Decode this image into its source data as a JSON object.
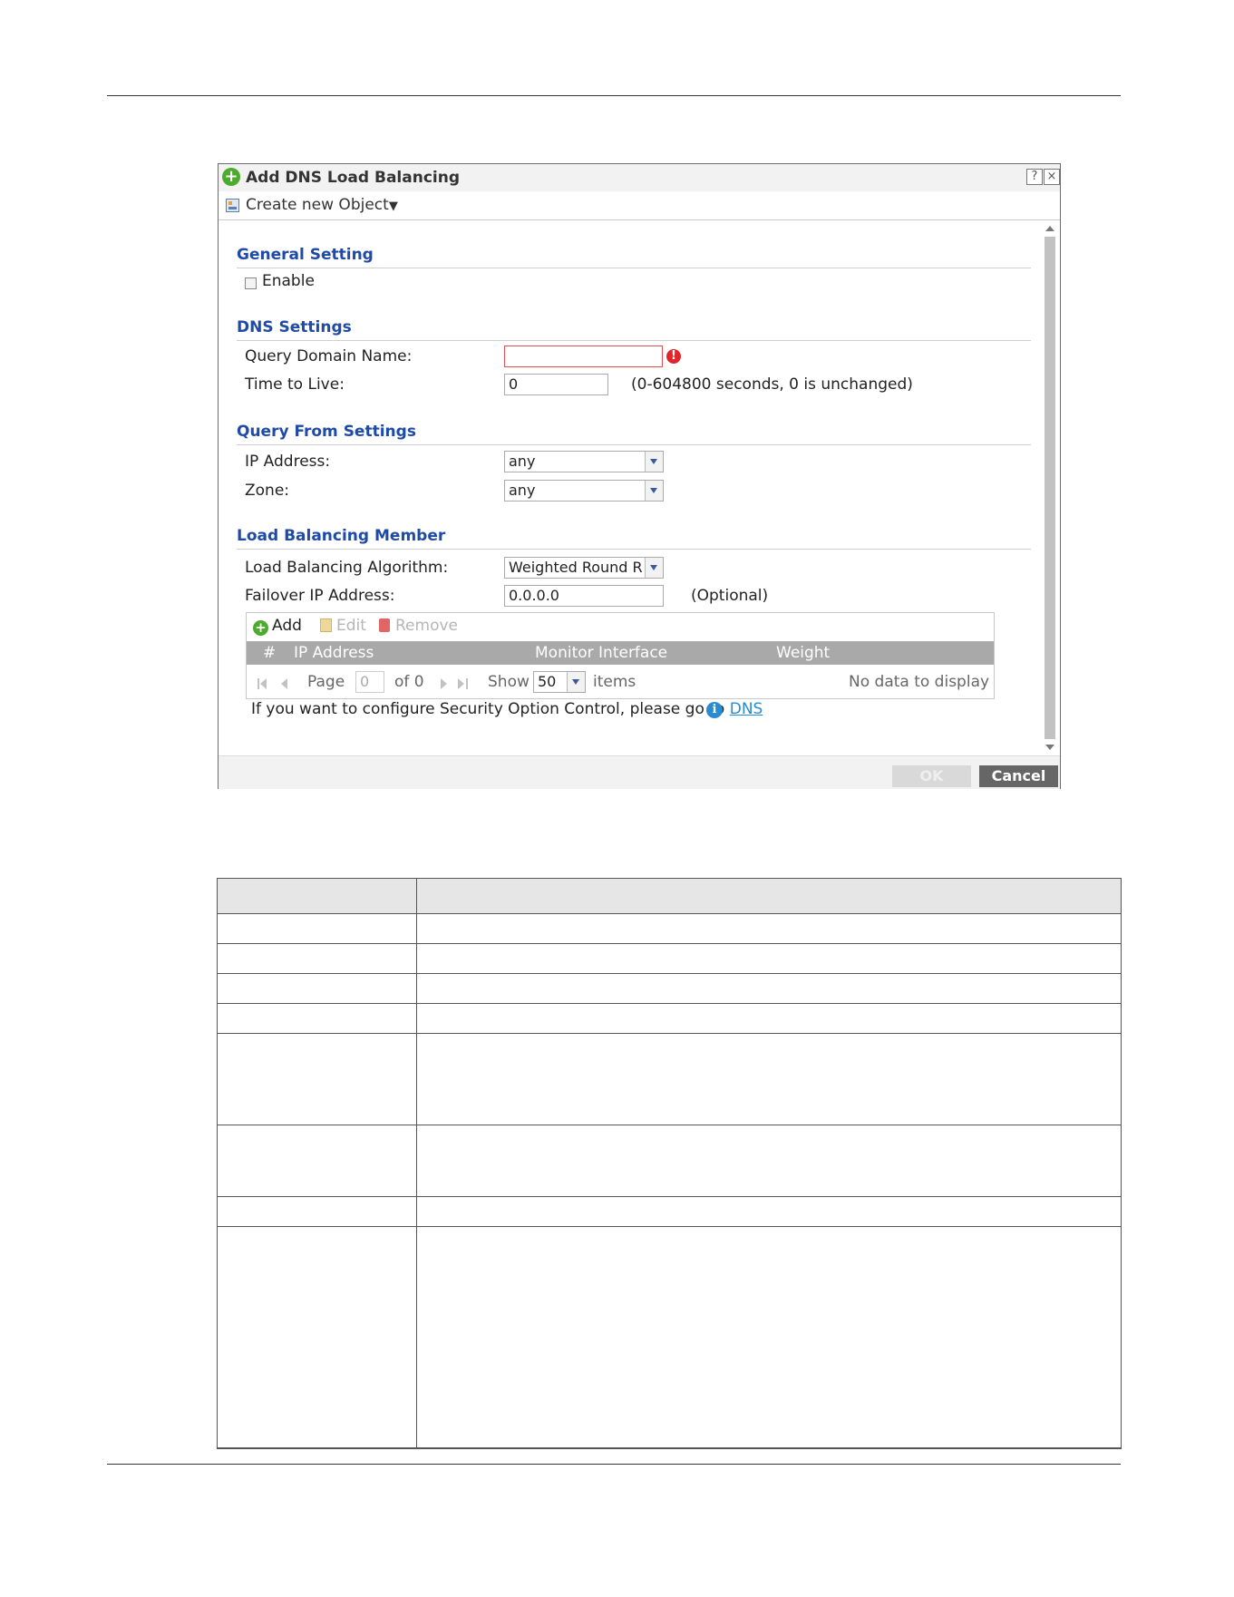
{
  "dialog": {
    "title": "Add DNS Load Balancing",
    "help_label": "?",
    "close_label": "×",
    "create_object_label": "Create new Object",
    "create_object_caret": "▼"
  },
  "general": {
    "section_title": "General Setting",
    "enable_label": "Enable",
    "enable_checked": false
  },
  "dns": {
    "section_title": "DNS Settings",
    "query_domain_label": "Query Domain Name:",
    "query_domain_value": "",
    "error_icon_glyph": "!",
    "ttl_label": "Time to Live:",
    "ttl_value": "0",
    "ttl_hint": "(0-604800 seconds, 0 is unchanged)"
  },
  "query_from": {
    "section_title": "Query From Settings",
    "ip_label": "IP Address:",
    "ip_value": "any",
    "zone_label": "Zone:",
    "zone_value": "any"
  },
  "member": {
    "section_title": "Load Balancing Member",
    "algorithm_label": "Load Balancing Algorithm:",
    "algorithm_value": "Weighted Round R",
    "failover_label": "Failover IP Address:",
    "failover_value": "0.0.0.0",
    "failover_hint": "(Optional)"
  },
  "grid": {
    "add_label": "Add",
    "edit_label": "Edit",
    "remove_label": "Remove",
    "columns": [
      "#",
      "IP Address",
      "Monitor Interface",
      "Weight"
    ],
    "page_label": "Page",
    "page_value": "0",
    "of_label": "of 0",
    "show_label": "Show",
    "page_size": "50",
    "items_label": "items",
    "empty_label": "No data to display"
  },
  "info": {
    "text": "If you want to configure Security Option Control, please go to ",
    "link": "DNS",
    "icon_glyph": "i"
  },
  "buttons": {
    "ok": "OK",
    "cancel": "Cancel"
  },
  "colors": {
    "section_title": "#1e4aa8",
    "add_green": "#4caa2c",
    "error_red": "#e0262a",
    "link_blue": "#2a8bd3",
    "grid_header": "#a9a9a9"
  }
}
